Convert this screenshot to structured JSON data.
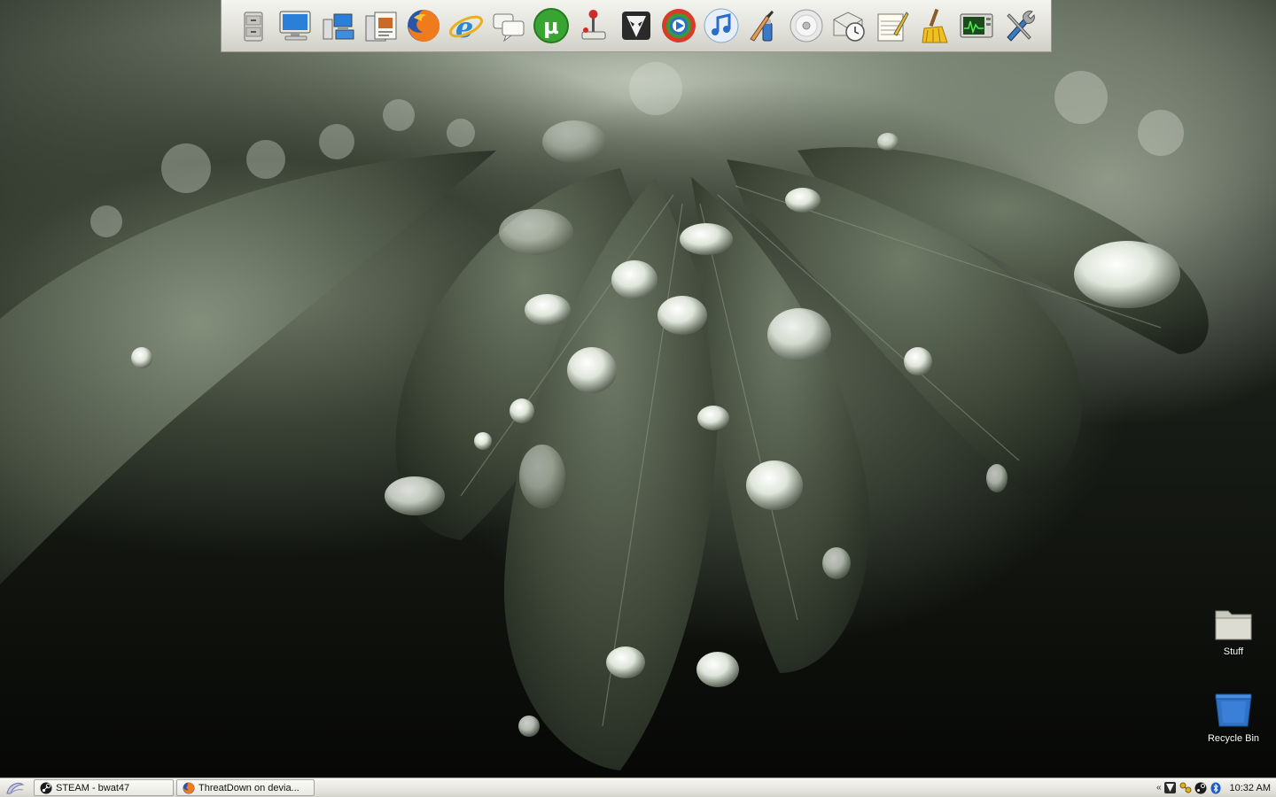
{
  "dock": {
    "items": [
      {
        "name": "file-cabinet-icon"
      },
      {
        "name": "my-computer-icon"
      },
      {
        "name": "network-icon"
      },
      {
        "name": "documents-icon"
      },
      {
        "name": "firefox-icon"
      },
      {
        "name": "internet-explorer-icon"
      },
      {
        "name": "chat-icon"
      },
      {
        "name": "utorrent-icon"
      },
      {
        "name": "joystick-icon"
      },
      {
        "name": "foobar-icon"
      },
      {
        "name": "media-player-icon"
      },
      {
        "name": "itunes-icon"
      },
      {
        "name": "paint-icon"
      },
      {
        "name": "cd-icon"
      },
      {
        "name": "mail-clock-icon"
      },
      {
        "name": "notepad-icon"
      },
      {
        "name": "ccleaner-icon"
      },
      {
        "name": "system-monitor-icon"
      },
      {
        "name": "tools-icon"
      }
    ]
  },
  "desktop": {
    "icons": [
      {
        "label": "Stuff",
        "icon": "folder-icon"
      },
      {
        "label": "Recycle Bin",
        "icon": "recycle-bin-icon"
      }
    ]
  },
  "taskbar": {
    "tasks": [
      {
        "label": "STEAM - bwat47",
        "icon": "steam-icon"
      },
      {
        "label": "ThreatDown on devia...",
        "icon": "firefox-icon"
      }
    ],
    "tray": {
      "expand": "«",
      "icons": [
        "foobar-tray-icon",
        "network-tray-icon",
        "steam-tray-icon",
        "bluetooth-tray-icon"
      ]
    },
    "clock": "10:32 AM"
  },
  "colors": {
    "dock_bg": "#e3e3dc",
    "taskbar_bg": "#e6e6df",
    "desktop_label": "#ffffff"
  }
}
